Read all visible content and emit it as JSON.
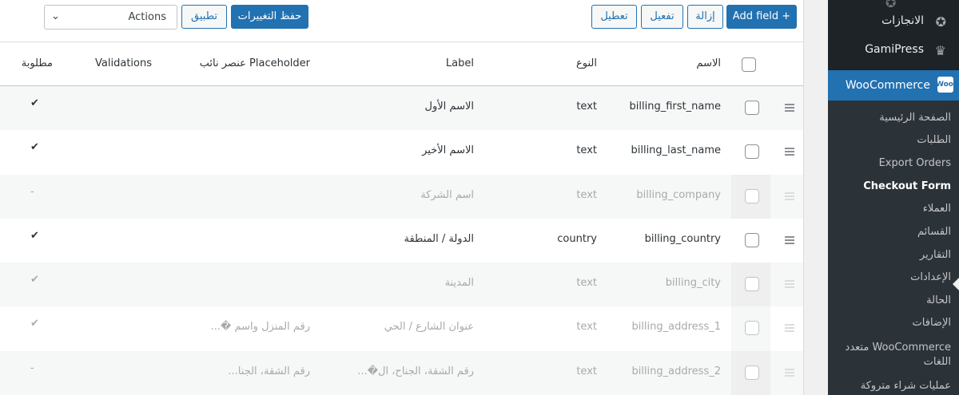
{
  "toolbar": {
    "add_field": "Add field +",
    "remove": "إزالة",
    "enable": "تفعيل",
    "disable": "تعطيل",
    "save_changes": "حفظ التغييرات",
    "apply": "تطبيق",
    "actions_select": "Actions"
  },
  "table": {
    "headers": {
      "name": "الاسم",
      "type": "النوع",
      "label": "Label",
      "placeholder": "عنصر نائب Placeholder",
      "validations": "Validations",
      "required": "مطلوبة"
    },
    "rows": [
      {
        "name": "billing_first_name",
        "type": "text",
        "label": "الاسم الأول",
        "placeholder": "",
        "validations": "",
        "required": "✔",
        "enabled": true
      },
      {
        "name": "billing_last_name",
        "type": "text",
        "label": "الاسم الأخير",
        "placeholder": "",
        "validations": "",
        "required": "✔",
        "enabled": true
      },
      {
        "name": "billing_company",
        "type": "text",
        "label": "اسم الشركة",
        "placeholder": "",
        "validations": "",
        "required": "-",
        "enabled": false
      },
      {
        "name": "billing_country",
        "type": "country",
        "label": "الدولة / المنطقة",
        "placeholder": "",
        "validations": "",
        "required": "✔",
        "enabled": true
      },
      {
        "name": "billing_city",
        "type": "text",
        "label": "المدينة",
        "placeholder": "",
        "validations": "",
        "required": "✔",
        "enabled": false
      },
      {
        "name": "billing_address_1",
        "type": "text",
        "label": "عنوان الشارع / الحي",
        "placeholder": "رقم المنزل واسم �...",
        "validations": "",
        "required": "✔",
        "enabled": false
      },
      {
        "name": "billing_address_2",
        "type": "text",
        "label": "رقم الشقة، الجناح، ال�...",
        "placeholder": "رقم الشقة، الجنا...",
        "validations": "",
        "required": "-",
        "enabled": false
      }
    ]
  },
  "sidebar": {
    "achievements": "الانجازات",
    "gamipress": "GamiPress",
    "woocommerce": "WooCommerce",
    "woo_badge": "Woo",
    "submenu": [
      {
        "label": "الصفحة الرئيسية",
        "current": false
      },
      {
        "label": "الطلبات",
        "current": false
      },
      {
        "label": "Export Orders",
        "current": false
      },
      {
        "label": "Checkout Form",
        "current": true
      },
      {
        "label": "العملاء",
        "current": false
      },
      {
        "label": "القسائم",
        "current": false
      },
      {
        "label": "التقارير",
        "current": false
      },
      {
        "label": "الإعدادات",
        "current": false
      },
      {
        "label": "الحالة",
        "current": false
      },
      {
        "label": "الإضافات",
        "current": false
      },
      {
        "label": "WooCommerce متعدد",
        "current": false
      },
      {
        "label": "اللغات",
        "current": false
      },
      {
        "label": "عمليات شراء متروكة",
        "current": false
      }
    ]
  },
  "colors": {
    "accent": "#2271b1",
    "sidebar_bg": "#1d2327",
    "submenu_bg": "#2c3338"
  }
}
